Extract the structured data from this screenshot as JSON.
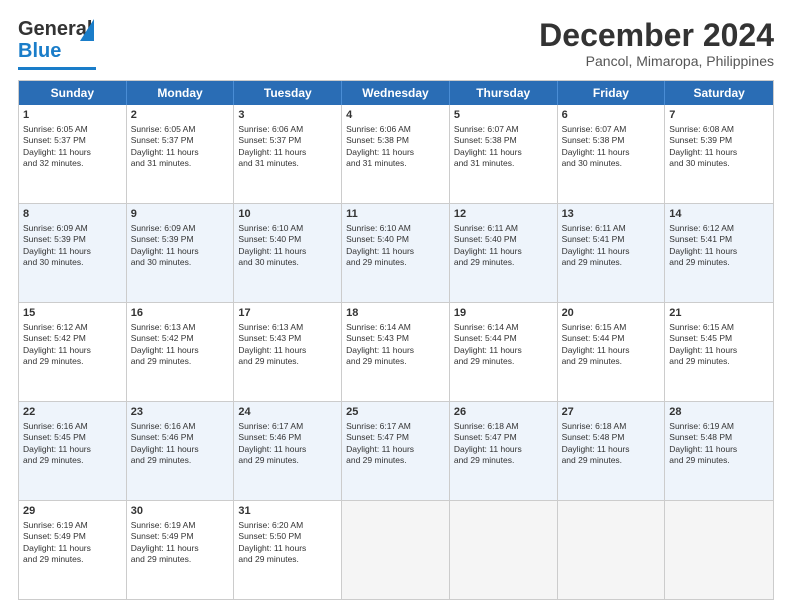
{
  "header": {
    "logo_general": "General",
    "logo_blue": "Blue",
    "month_title": "December 2024",
    "location": "Pancol, Mimaropa, Philippines"
  },
  "days_of_week": [
    "Sunday",
    "Monday",
    "Tuesday",
    "Wednesday",
    "Thursday",
    "Friday",
    "Saturday"
  ],
  "weeks": [
    [
      {
        "day": "1",
        "lines": [
          "Sunrise: 6:05 AM",
          "Sunset: 5:37 PM",
          "Daylight: 11 hours",
          "and 32 minutes."
        ]
      },
      {
        "day": "2",
        "lines": [
          "Sunrise: 6:05 AM",
          "Sunset: 5:37 PM",
          "Daylight: 11 hours",
          "and 31 minutes."
        ]
      },
      {
        "day": "3",
        "lines": [
          "Sunrise: 6:06 AM",
          "Sunset: 5:37 PM",
          "Daylight: 11 hours",
          "and 31 minutes."
        ]
      },
      {
        "day": "4",
        "lines": [
          "Sunrise: 6:06 AM",
          "Sunset: 5:38 PM",
          "Daylight: 11 hours",
          "and 31 minutes."
        ]
      },
      {
        "day": "5",
        "lines": [
          "Sunrise: 6:07 AM",
          "Sunset: 5:38 PM",
          "Daylight: 11 hours",
          "and 31 minutes."
        ]
      },
      {
        "day": "6",
        "lines": [
          "Sunrise: 6:07 AM",
          "Sunset: 5:38 PM",
          "Daylight: 11 hours",
          "and 30 minutes."
        ]
      },
      {
        "day": "7",
        "lines": [
          "Sunrise: 6:08 AM",
          "Sunset: 5:39 PM",
          "Daylight: 11 hours",
          "and 30 minutes."
        ]
      }
    ],
    [
      {
        "day": "8",
        "lines": [
          "Sunrise: 6:09 AM",
          "Sunset: 5:39 PM",
          "Daylight: 11 hours",
          "and 30 minutes."
        ]
      },
      {
        "day": "9",
        "lines": [
          "Sunrise: 6:09 AM",
          "Sunset: 5:39 PM",
          "Daylight: 11 hours",
          "and 30 minutes."
        ]
      },
      {
        "day": "10",
        "lines": [
          "Sunrise: 6:10 AM",
          "Sunset: 5:40 PM",
          "Daylight: 11 hours",
          "and 30 minutes."
        ]
      },
      {
        "day": "11",
        "lines": [
          "Sunrise: 6:10 AM",
          "Sunset: 5:40 PM",
          "Daylight: 11 hours",
          "and 29 minutes."
        ]
      },
      {
        "day": "12",
        "lines": [
          "Sunrise: 6:11 AM",
          "Sunset: 5:40 PM",
          "Daylight: 11 hours",
          "and 29 minutes."
        ]
      },
      {
        "day": "13",
        "lines": [
          "Sunrise: 6:11 AM",
          "Sunset: 5:41 PM",
          "Daylight: 11 hours",
          "and 29 minutes."
        ]
      },
      {
        "day": "14",
        "lines": [
          "Sunrise: 6:12 AM",
          "Sunset: 5:41 PM",
          "Daylight: 11 hours",
          "and 29 minutes."
        ]
      }
    ],
    [
      {
        "day": "15",
        "lines": [
          "Sunrise: 6:12 AM",
          "Sunset: 5:42 PM",
          "Daylight: 11 hours",
          "and 29 minutes."
        ]
      },
      {
        "day": "16",
        "lines": [
          "Sunrise: 6:13 AM",
          "Sunset: 5:42 PM",
          "Daylight: 11 hours",
          "and 29 minutes."
        ]
      },
      {
        "day": "17",
        "lines": [
          "Sunrise: 6:13 AM",
          "Sunset: 5:43 PM",
          "Daylight: 11 hours",
          "and 29 minutes."
        ]
      },
      {
        "day": "18",
        "lines": [
          "Sunrise: 6:14 AM",
          "Sunset: 5:43 PM",
          "Daylight: 11 hours",
          "and 29 minutes."
        ]
      },
      {
        "day": "19",
        "lines": [
          "Sunrise: 6:14 AM",
          "Sunset: 5:44 PM",
          "Daylight: 11 hours",
          "and 29 minutes."
        ]
      },
      {
        "day": "20",
        "lines": [
          "Sunrise: 6:15 AM",
          "Sunset: 5:44 PM",
          "Daylight: 11 hours",
          "and 29 minutes."
        ]
      },
      {
        "day": "21",
        "lines": [
          "Sunrise: 6:15 AM",
          "Sunset: 5:45 PM",
          "Daylight: 11 hours",
          "and 29 minutes."
        ]
      }
    ],
    [
      {
        "day": "22",
        "lines": [
          "Sunrise: 6:16 AM",
          "Sunset: 5:45 PM",
          "Daylight: 11 hours",
          "and 29 minutes."
        ]
      },
      {
        "day": "23",
        "lines": [
          "Sunrise: 6:16 AM",
          "Sunset: 5:46 PM",
          "Daylight: 11 hours",
          "and 29 minutes."
        ]
      },
      {
        "day": "24",
        "lines": [
          "Sunrise: 6:17 AM",
          "Sunset: 5:46 PM",
          "Daylight: 11 hours",
          "and 29 minutes."
        ]
      },
      {
        "day": "25",
        "lines": [
          "Sunrise: 6:17 AM",
          "Sunset: 5:47 PM",
          "Daylight: 11 hours",
          "and 29 minutes."
        ]
      },
      {
        "day": "26",
        "lines": [
          "Sunrise: 6:18 AM",
          "Sunset: 5:47 PM",
          "Daylight: 11 hours",
          "and 29 minutes."
        ]
      },
      {
        "day": "27",
        "lines": [
          "Sunrise: 6:18 AM",
          "Sunset: 5:48 PM",
          "Daylight: 11 hours",
          "and 29 minutes."
        ]
      },
      {
        "day": "28",
        "lines": [
          "Sunrise: 6:19 AM",
          "Sunset: 5:48 PM",
          "Daylight: 11 hours",
          "and 29 minutes."
        ]
      }
    ],
    [
      {
        "day": "29",
        "lines": [
          "Sunrise: 6:19 AM",
          "Sunset: 5:49 PM",
          "Daylight: 11 hours",
          "and 29 minutes."
        ]
      },
      {
        "day": "30",
        "lines": [
          "Sunrise: 6:19 AM",
          "Sunset: 5:49 PM",
          "Daylight: 11 hours",
          "and 29 minutes."
        ]
      },
      {
        "day": "31",
        "lines": [
          "Sunrise: 6:20 AM",
          "Sunset: 5:50 PM",
          "Daylight: 11 hours",
          "and 29 minutes."
        ]
      },
      {
        "day": "",
        "lines": []
      },
      {
        "day": "",
        "lines": []
      },
      {
        "day": "",
        "lines": []
      },
      {
        "day": "",
        "lines": []
      }
    ]
  ],
  "alt_rows": [
    1,
    3
  ]
}
